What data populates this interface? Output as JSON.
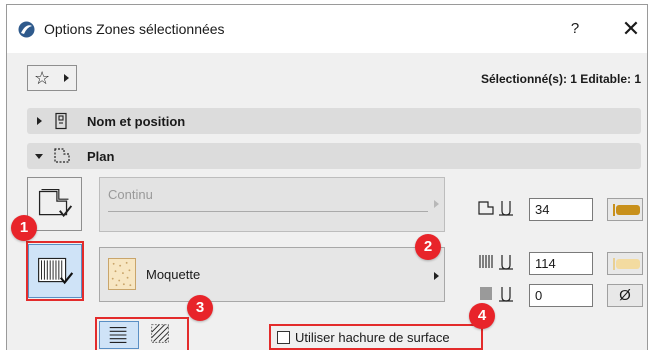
{
  "window": {
    "title": "Options Zones sélectionnées",
    "help_label": "?",
    "close_label": "✕"
  },
  "toolbar": {
    "favorites_icon": "star-icon",
    "selection_info": "Sélectionné(s): 1 Editable: 1"
  },
  "sections": {
    "name_position": {
      "label": "Nom et position",
      "expanded": false,
      "icon": "zone-stamp-icon"
    },
    "plan": {
      "label": "Plan",
      "expanded": true,
      "icon": "plan-zone-icon"
    }
  },
  "plan": {
    "contour_line": {
      "label": "Continu",
      "enabled": false
    },
    "cover_fill": {
      "label": "Moquette",
      "swatch_color": "#f7e6c2"
    },
    "contour_pen": {
      "value": "34",
      "pen_color": "#c8901b"
    },
    "fill_pen": {
      "value": "114",
      "pen_color": "#f3dba0"
    },
    "background_pen": {
      "value": "0",
      "pen_symbol": "Ø"
    },
    "surface_hatch_checkbox": {
      "label": "Utiliser hachure de surface",
      "checked": false
    }
  },
  "badges": [
    "1",
    "2",
    "3",
    "4"
  ],
  "colors": {
    "accent_red": "#e32b2b",
    "active_blue": "#cfe3f7"
  }
}
